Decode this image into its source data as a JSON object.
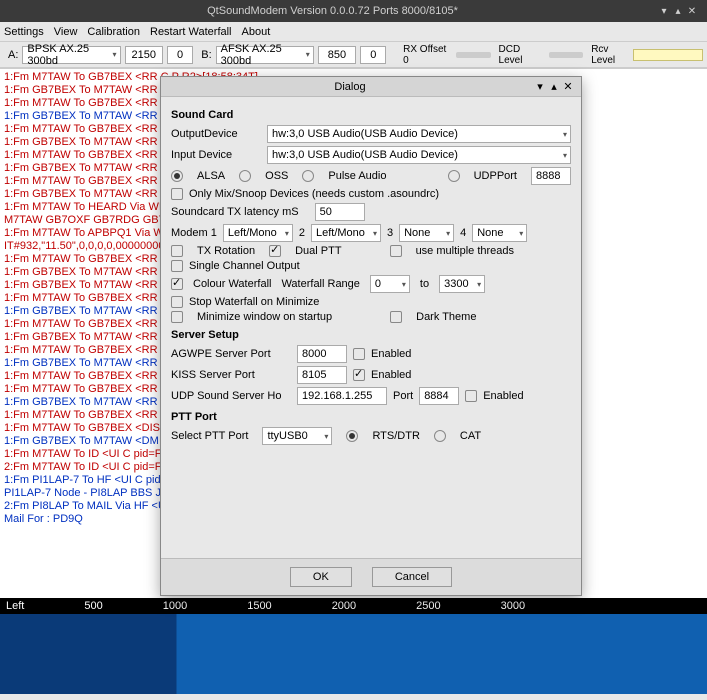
{
  "window": {
    "title": "QtSoundModem Version 0.0.0.72 Ports 8000/8105*",
    "controls": {
      "min": "▾",
      "max": "▴",
      "close": "✕"
    }
  },
  "menubar": [
    "Settings",
    "View",
    "Calibration",
    "Restart Waterfall",
    "About"
  ],
  "toolbar": {
    "a_label": "A:",
    "a_mode": "BPSK AX.25 300bd",
    "a_freq": "2150",
    "a_zero": "0",
    "b_label": "B:",
    "b_mode": "AFSK AX.25 300bd",
    "b_freq": "850",
    "b_zero": "0",
    "rx_offset": "RX Offset 0",
    "dcd_level": "DCD Level",
    "rcv_level": "Rcv Level"
  },
  "log": [
    {
      "c": "red",
      "t": "1:Fm M7TAW To GB7BEX <RR C  P R2>[18:58:34T]"
    },
    {
      "c": "red",
      "t": "1:Fm GB7BEX To M7TAW <RR C  P R0>"
    },
    {
      "c": "red",
      "t": "1:Fm M7TAW To GB7BEX <RR R  F R2>"
    },
    {
      "c": "blue",
      "t": "1:Fm GB7BEX To M7TAW <RR R  F R2>"
    },
    {
      "c": "red",
      "t": "1:Fm M7TAW To GB7BEX <RR C  P R2>"
    },
    {
      "c": "red",
      "t": "1:Fm GB7BEX To M7TAW <RR R  F R0>"
    },
    {
      "c": "red",
      "t": "1:Fm M7TAW To GB7BEX <RR C  P R2>"
    },
    {
      "c": "red",
      "t": "1:Fm GB7BEX To M7TAW <RR R  F R0>"
    },
    {
      "c": "red",
      "t": "1:Fm M7TAW To GB7BEX <RR C  P R2>"
    },
    {
      "c": "red",
      "t": "1:Fm GB7BEX To M7TAW <RR R  F R2>"
    },
    {
      "c": "red",
      "t": "1:Fm M7TAW To HEARD Via WIDE1-1"
    },
    {
      "c": "red",
      "t": "M7TAW GB7OXF GB7RDG GB7BPQ GB7"
    },
    {
      "c": "red",
      "t": "1:Fm M7TAW To APBPQ1 Via WIDE1-1"
    },
    {
      "c": "red",
      "t": "IT#932,\"11.50\",0,0,0,0,00000000"
    },
    {
      "c": "red",
      "t": "1:Fm M7TAW To GB7BEX <RR C  P R2>"
    },
    {
      "c": "red",
      "t": "1:Fm GB7BEX To M7TAW <RR C  F R2>"
    },
    {
      "c": "red",
      "t": "1:Fm GB7BEX To M7TAW <RR C  P R2>"
    },
    {
      "c": "red",
      "t": "1:Fm M7TAW To GB7BEX <RR C  P R2>"
    },
    {
      "c": "blue",
      "t": "1:Fm GB7BEX To M7TAW <RR R  F R0>"
    },
    {
      "c": "red",
      "t": "1:Fm M7TAW To GB7BEX <RR R  F R2>"
    },
    {
      "c": "red",
      "t": "1:Fm GB7BEX To M7TAW <RR C  P R0>"
    },
    {
      "c": "red",
      "t": "1:Fm M7TAW To GB7BEX <RR C  P R2>"
    },
    {
      "c": "blue",
      "t": "1:Fm GB7BEX To M7TAW <RR C  P R2>"
    },
    {
      "c": "red",
      "t": "1:Fm M7TAW To GB7BEX <RR R  F R2>"
    },
    {
      "c": "red",
      "t": "1:Fm M7TAW To GB7BEX <RR C  P R2>"
    },
    {
      "c": "blue",
      "t": "1:Fm GB7BEX To M7TAW <RR R  F R0>"
    },
    {
      "c": "red",
      "t": "1:Fm M7TAW To GB7BEX <RR C  P R2>"
    },
    {
      "c": "red",
      "t": "1:Fm M7TAW To GB7BEX <DISC C  P>"
    },
    {
      "c": "blue",
      "t": "1:Fm GB7BEX To M7TAW <DM R  F>["
    },
    {
      "c": "red",
      "t": "1:Fm M7TAW To ID <UI C  pid=F0 Len"
    },
    {
      "c": "red",
      "t": ""
    },
    {
      "c": "red",
      "t": "2:Fm M7TAW To ID <UI C  pid=F0 Len"
    },
    {
      "c": "red",
      "t": ""
    },
    {
      "c": "blue",
      "t": "1:Fm PI1LAP-7 To HF <UI C  pid=F0 Le"
    },
    {
      "c": "blue",
      "t": "PI1LAP-7 Node - PI8LAP BBS JO11VN"
    },
    {
      "c": "blue",
      "t": "2:Fm PI8LAP To MAIL Via HF <UI C pid"
    },
    {
      "c": "blue",
      "t": "Mail For : PD9Q"
    }
  ],
  "ruler": {
    "left": "Left",
    "ticks": [
      "500",
      "1000",
      "1500",
      "2000",
      "2500",
      "3000"
    ]
  },
  "dialog": {
    "title": "Dialog",
    "soundcard": {
      "heading": "Sound Card",
      "output_label": "OutputDevice",
      "output_value": "hw:3,0 USB Audio(USB Audio Device)",
      "input_label": "Input Device",
      "input_value": "hw:3,0 USB Audio(USB Audio Device)",
      "alsa": "ALSA",
      "oss": "OSS",
      "pulse": "Pulse Audio",
      "udp": "UDPPort",
      "udp_val": "8888",
      "mixsnoop": "Only Mix/Snoop Devices (needs custom .asoundrc)",
      "latency_label": "Soundcard TX latency mS",
      "latency_val": "50",
      "modem1": "Modem 1",
      "m1v": "Left/Mono",
      "m2": "2",
      "m2v": "Left/Mono",
      "m3": "3",
      "m3v": "None",
      "m4": "4",
      "m4v": "None",
      "tx_rotation": "TX Rotation",
      "dual_ptt": "Dual PTT",
      "multi_threads": "use multiple threads",
      "single_channel": "Single Channel Output",
      "colour_waterfall": "Colour Waterfall",
      "wf_range": "Waterfall Range",
      "wf_lo": "0",
      "to": "to",
      "wf_hi": "3300",
      "stop_wf": "Stop Waterfall on Minimize",
      "min_startup": "Minimize window on startup",
      "dark_theme": "Dark Theme"
    },
    "server": {
      "heading": "Server Setup",
      "agwpe_label": "AGWPE Server Port",
      "agwpe_val": "8000",
      "agwpe_en": "Enabled",
      "kiss_label": "KISS Server Port",
      "kiss_val": "8105",
      "kiss_en": "Enabled",
      "udp_label": "UDP Sound Server Ho",
      "udp_val": "192.168.1.255",
      "port_label": "Port",
      "port_val": "8884",
      "udp_en": "Enabled"
    },
    "ptt": {
      "heading": "PTT Port",
      "select_label": "Select PTT Port",
      "port_val": "ttyUSB0",
      "rts": "RTS/DTR",
      "cat": "CAT"
    },
    "buttons": {
      "ok": "OK",
      "cancel": "Cancel"
    }
  }
}
